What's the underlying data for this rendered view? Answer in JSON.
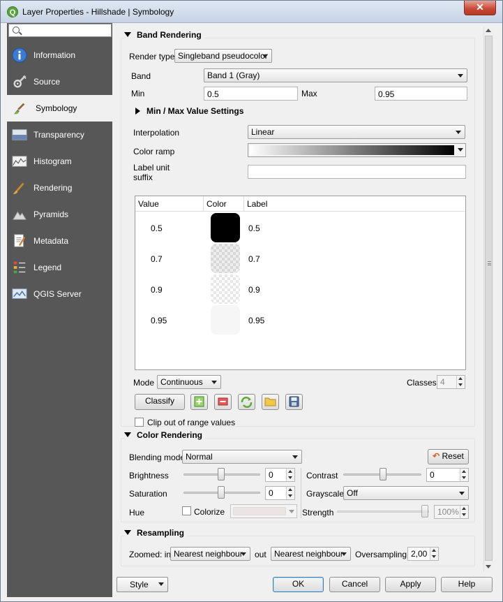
{
  "window": {
    "title": "Layer Properties - Hillshade | Symbology",
    "close_label": "✕",
    "logo_letter": "Q"
  },
  "sidebar": {
    "search_placeholder": "",
    "items": [
      {
        "label": "Information",
        "icon": "info-icon"
      },
      {
        "label": "Source",
        "icon": "source-icon"
      },
      {
        "label": "Symbology",
        "icon": "symbology-icon",
        "active": true
      },
      {
        "label": "Transparency",
        "icon": "transparency-icon"
      },
      {
        "label": "Histogram",
        "icon": "histogram-icon"
      },
      {
        "label": "Rendering",
        "icon": "rendering-icon"
      },
      {
        "label": "Pyramids",
        "icon": "pyramids-icon"
      },
      {
        "label": "Metadata",
        "icon": "metadata-icon"
      },
      {
        "label": "Legend",
        "icon": "legend-icon"
      },
      {
        "label": "QGIS Server",
        "icon": "qgis-server-icon"
      }
    ]
  },
  "band_rendering": {
    "title": "Band Rendering",
    "render_type_label": "Render type",
    "render_type_value": "Singleband pseudocolor",
    "band_label": "Band",
    "band_value": "Band 1 (Gray)",
    "min_label": "Min",
    "min_value": "0.5",
    "max_label": "Max",
    "max_value": "0.95",
    "minmax_settings": "Min / Max Value Settings",
    "interpolation_label": "Interpolation",
    "interpolation_value": "Linear",
    "color_ramp_label": "Color ramp",
    "label_unit_suffix_line1": "Label unit",
    "label_unit_suffix_line2": "suffix",
    "label_unit_suffix_value": "",
    "table": {
      "headers": [
        "Value",
        "Color",
        "Label"
      ],
      "rows": [
        {
          "value": "0.5",
          "color": "#000000",
          "label": "0.5"
        },
        {
          "value": "0.7",
          "color": "transparent-dark",
          "label": "0.7"
        },
        {
          "value": "0.9",
          "color": "transparent-light",
          "label": "0.9"
        },
        {
          "value": "0.95",
          "color": "#f6f6f6",
          "label": "0.95"
        }
      ]
    },
    "mode_label": "Mode",
    "mode_value": "Continuous",
    "classes_label": "Classes",
    "classes_value": "4",
    "classify_label": "Classify",
    "clip_label": "Clip out of range values"
  },
  "color_rendering": {
    "title": "Color Rendering",
    "blending_label": "Blending mode",
    "blending_value": "Normal",
    "reset_label": "Reset",
    "brightness_label": "Brightness",
    "brightness_value": "0",
    "contrast_label": "Contrast",
    "contrast_value": "0",
    "saturation_label": "Saturation",
    "saturation_value": "0",
    "grayscale_label": "Grayscale",
    "grayscale_value": "Off",
    "hue_label": "Hue",
    "colorize_label": "Colorize",
    "strength_label": "Strength",
    "strength_value": "100%"
  },
  "resampling": {
    "title": "Resampling",
    "zoomed_in_label": "Zoomed: in",
    "zoomed_in_value": "Nearest neighbour",
    "out_label": "out",
    "out_value": "Nearest neighbour",
    "oversampling_label": "Oversampling",
    "oversampling_value": "2,00"
  },
  "footer": {
    "style": "Style",
    "ok": "OK",
    "cancel": "Cancel",
    "apply": "Apply",
    "help": "Help"
  }
}
